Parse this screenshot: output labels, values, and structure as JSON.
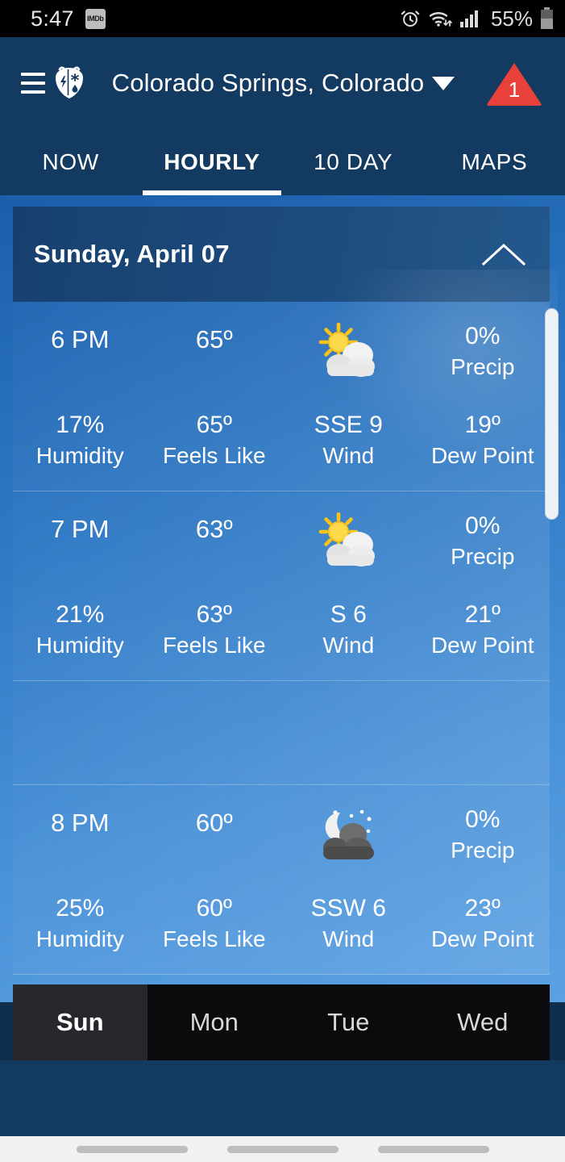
{
  "status_bar": {
    "time": "5:47",
    "app_icon_label": "IMDb",
    "battery_percent": "55%",
    "icons": [
      "alarm-clock-icon",
      "wifi-icon",
      "cell-signal-icon",
      "battery-icon"
    ]
  },
  "header": {
    "menu_icon": "hamburger-menu-icon",
    "logo_icon": "weatherbug-logo-icon",
    "location": "Colorado Springs, Colorado",
    "location_caret": "chevron-down-icon",
    "alert_count": "1",
    "alert_icon": "warning-triangle-icon",
    "alert_color": "#e8403a"
  },
  "tabs": [
    {
      "label": "NOW",
      "active": false
    },
    {
      "label": "HOURLY",
      "active": true
    },
    {
      "label": "10 DAY",
      "active": false
    },
    {
      "label": "MAPS",
      "active": false
    }
  ],
  "day_section": {
    "title": "Sunday, April 07",
    "collapse_icon": "chevron-up-icon"
  },
  "labels": {
    "precip": "Precip",
    "humidity": "Humidity",
    "feels_like": "Feels Like",
    "wind": "Wind",
    "dew_point": "Dew Point"
  },
  "hours": [
    {
      "time": "6 PM",
      "temp": "65º",
      "condition_icon": "sun-behind-cloud-icon",
      "precip": "0%",
      "humidity": "17%",
      "feels_like": "65º",
      "wind": "SSE 9",
      "dew_point": "19º",
      "blank": false
    },
    {
      "time": "7 PM",
      "temp": "63º",
      "condition_icon": "sun-behind-cloud-icon",
      "precip": "0%",
      "humidity": "21%",
      "feels_like": "63º",
      "wind": "S 6",
      "dew_point": "21º",
      "blank": false
    },
    {
      "time": "",
      "temp": "",
      "condition_icon": "",
      "precip": "",
      "humidity": "",
      "feels_like": "",
      "wind": "",
      "dew_point": "",
      "blank": true
    },
    {
      "time": "8 PM",
      "temp": "60º",
      "condition_icon": "moon-behind-cloud-icon",
      "precip": "0%",
      "humidity": "25%",
      "feels_like": "60º",
      "wind": "SSW 6",
      "dew_point": "23º",
      "blank": false
    }
  ],
  "day_selector": [
    {
      "label": "Sun",
      "active": true
    },
    {
      "label": "Mon",
      "active": false
    },
    {
      "label": "Tue",
      "active": false
    },
    {
      "label": "Wed",
      "active": false
    }
  ],
  "colors": {
    "header_blue": "#133a60",
    "card_blue": "#3a7bc0",
    "alert_red": "#e8403a",
    "day_header_navy": "#1d4d80"
  }
}
